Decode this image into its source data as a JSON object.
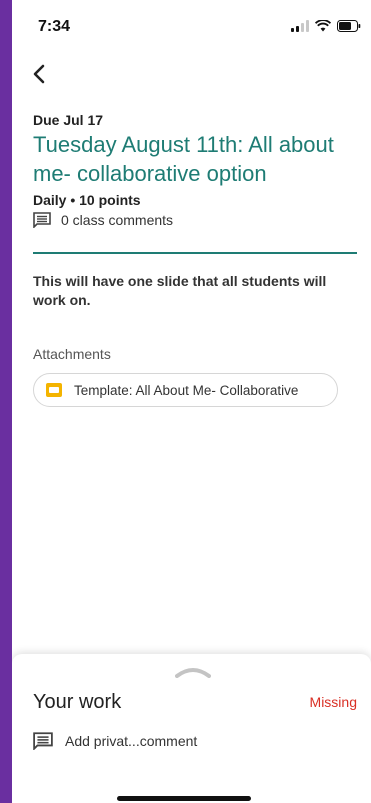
{
  "status_bar": {
    "time": "7:34"
  },
  "assignment": {
    "due": "Due Jul 17",
    "title": "Tuesday August 11th: All about me- collaborative option",
    "meta": "Daily • 10 points",
    "comments": "0 class comments",
    "description": "This will have one slide that all students will work on.",
    "attachments_label": "Attachments",
    "attachment_name": "Template: All About Me- Collaborative"
  },
  "work_sheet": {
    "title": "Your work",
    "status": "Missing",
    "private_comment": "Add privat...comment"
  },
  "colors": {
    "accent": "#1e7c74",
    "missing": "#d93025",
    "slides": "#f4b400",
    "frame": "#6a2fa0"
  }
}
